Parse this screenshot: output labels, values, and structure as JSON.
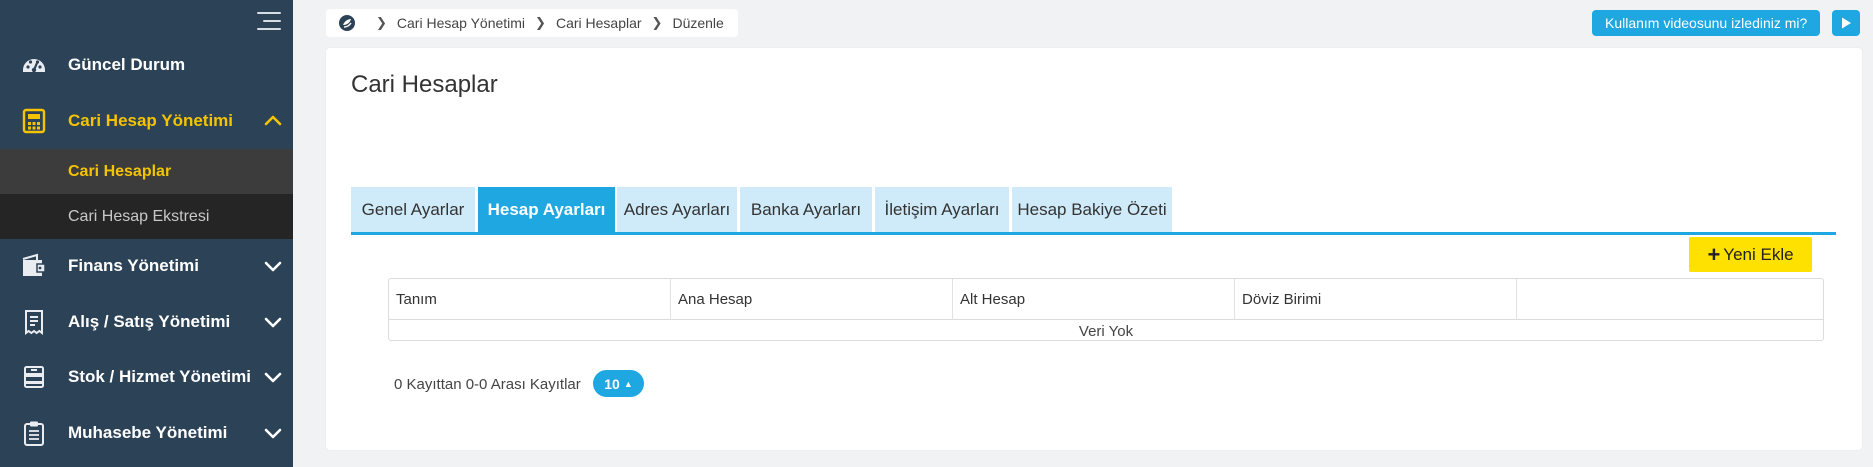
{
  "sidebar": {
    "items": [
      {
        "label": "Güncel Durum",
        "icon": "dashboard-gauge-icon"
      },
      {
        "label": "Cari Hesap Yönetimi",
        "icon": "calculator-icon",
        "active": true,
        "expanded": true
      },
      {
        "label": "Finans Yönetimi",
        "icon": "finance-wallet-icon"
      },
      {
        "label": "Alış / Satış Yönetimi",
        "icon": "receipt-icon"
      },
      {
        "label": "Stok / Hizmet Yönetimi",
        "icon": "stock-box-icon"
      },
      {
        "label": "Muhasebe Yönetimi",
        "icon": "clipboard-icon"
      }
    ],
    "subitems": [
      {
        "label": "Cari Hesaplar",
        "active": true
      },
      {
        "label": "Cari Hesap Ekstresi"
      }
    ]
  },
  "breadcrumb": {
    "items": [
      "Cari Hesap Yönetimi",
      "Cari Hesaplar",
      "Düzenle"
    ]
  },
  "help": {
    "video_label": "Kullanım videosunu izlediniz mi?"
  },
  "page": {
    "title": "Cari Hesaplar"
  },
  "tabs": [
    {
      "label": "Genel Ayarlar"
    },
    {
      "label": "Hesap Ayarları",
      "active": true
    },
    {
      "label": "Adres Ayarları"
    },
    {
      "label": "Banka Ayarları"
    },
    {
      "label": "İletişim Ayarları"
    },
    {
      "label": "Hesap Bakiye Özeti"
    }
  ],
  "toolbar": {
    "add_label": "Yeni Ekle"
  },
  "table": {
    "columns": [
      "Tanım",
      "Ana Hesap",
      "Alt Hesap",
      "Döviz Birimi",
      ""
    ],
    "empty_text": "Veri Yok"
  },
  "pager": {
    "records_text": "0 Kayıttan 0-0 Arası Kayıtlar",
    "page_size": "10"
  },
  "colors": {
    "sidebar_bg": "#2c4257",
    "accent_blue": "#1ea7e1",
    "active_yellow": "#f5c400",
    "add_button_yellow": "#ffe100"
  }
}
